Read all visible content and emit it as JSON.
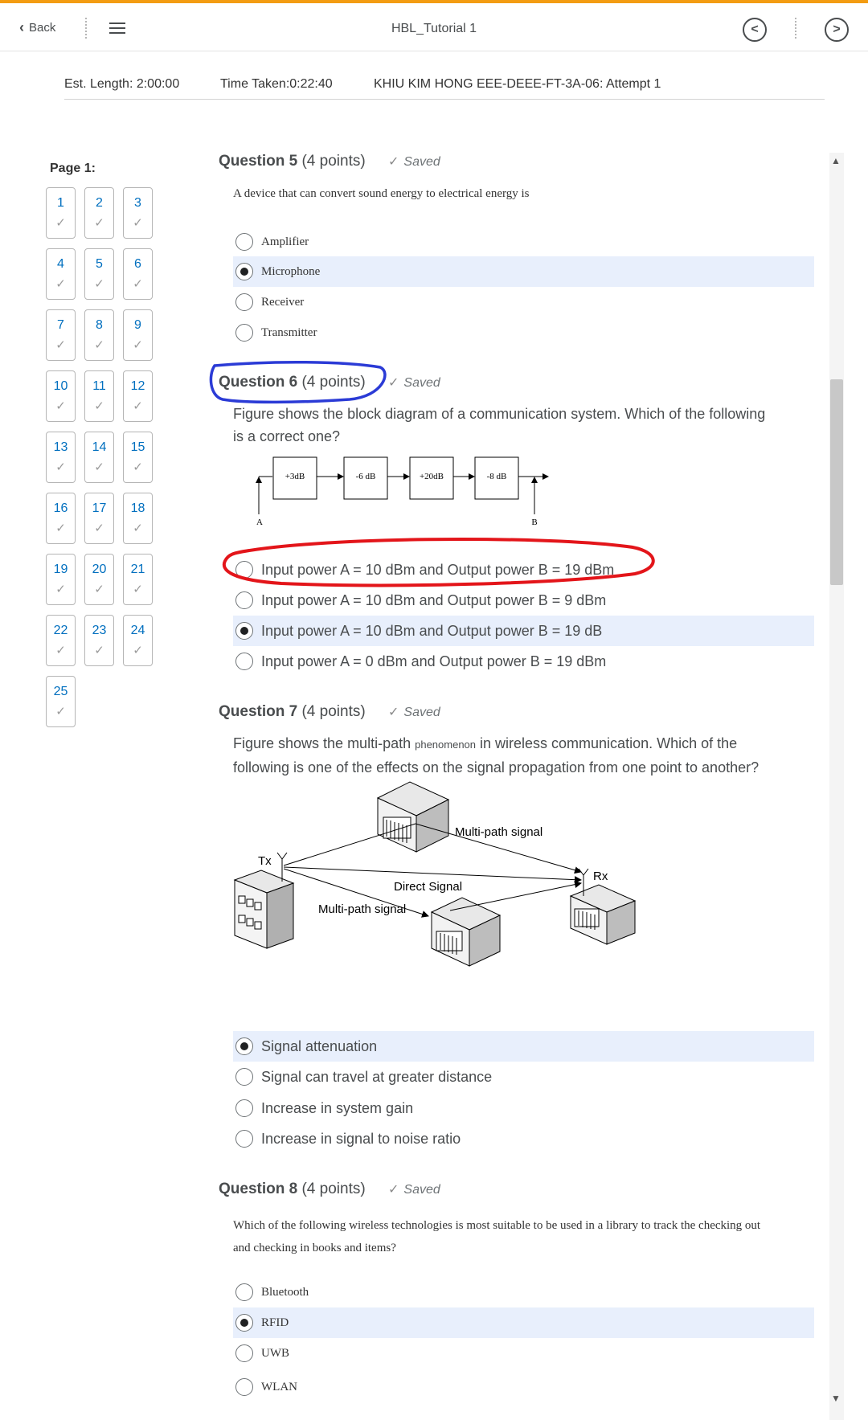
{
  "topbar": {
    "back_label": "Back",
    "title": "HBL_Tutorial 1",
    "prev_glyph": "<",
    "next_glyph": ">",
    "accent_color": "#f39c12"
  },
  "info": {
    "est_length": "Est. Length: 2:00:00",
    "time_taken": "Time Taken:0:22:40",
    "attempt": "KHIU KIM HONG EEE-DEEE-FT-3A-06: Attempt 1"
  },
  "nav": {
    "page_label": "Page 1:",
    "check_glyph": "✓",
    "questions": [
      "1",
      "2",
      "3",
      "4",
      "5",
      "6",
      "7",
      "8",
      "9",
      "10",
      "11",
      "12",
      "13",
      "14",
      "15",
      "16",
      "17",
      "18",
      "19",
      "20",
      "21",
      "22",
      "23",
      "24",
      "25"
    ]
  },
  "questions": {
    "q5": {
      "title": "Question 5",
      "points": "(4 points)",
      "status": "Saved",
      "text": "A device that can convert sound energy to electrical energy is",
      "options": [
        "Amplifier",
        "Microphone",
        "Receiver",
        "Transmitter"
      ],
      "selected": 1
    },
    "q6": {
      "title": "Question 6",
      "points": "(4 points)",
      "status": "Saved",
      "text_line1": "Figure shows the block diagram of a communication system. Which of the following",
      "text_line2": "is a correct one?",
      "diagram": {
        "blocks": [
          "+3dB",
          "-6 dB",
          "+20dB",
          "-8 dB"
        ],
        "label_a": "A",
        "label_b": "B"
      },
      "options": [
        "Input power A = 10 dBm and Output power B = 19 dBm",
        "Input power A = 10 dBm and Output power B = 9 dBm",
        "Input power A = 10 dBm and Output power B = 19 dB",
        "Input power A = 0 dBm and Output power B = 19 dBm"
      ],
      "selected": 2,
      "annotation_colors": {
        "title_circle": "#2b3bd6",
        "option_circle": "#e3151a"
      }
    },
    "q7": {
      "title": "Question 7",
      "points": "(4 points)",
      "status": "Saved",
      "text_line1_a": "Figure shows the multi-path ",
      "text_line1_small": "phenomenon",
      "text_line1_b": " in wireless communication. Which of the",
      "text_line2": "following is one of the effects on the signal propagation from one point to another?",
      "figure": {
        "multipath_top": "Multi-path signal",
        "tx": "Tx",
        "rx": "Rx",
        "direct": "Direct Signal",
        "multipath_bottom": "Multi-path signal"
      },
      "options": [
        "Signal attenuation",
        "Signal can travel at greater distance",
        "Increase in system gain",
        "Increase in signal to noise ratio"
      ],
      "selected": 0
    },
    "q8": {
      "title": "Question 8",
      "points": "(4 points)",
      "status": "Saved",
      "text_line1": "Which of the following wireless technologies is most suitable to be used in a library to track the checking out",
      "text_line2": "and checking in books and items?",
      "options": [
        "Bluetooth",
        "RFID",
        "UWB",
        "WLAN"
      ],
      "selected": 1
    }
  }
}
